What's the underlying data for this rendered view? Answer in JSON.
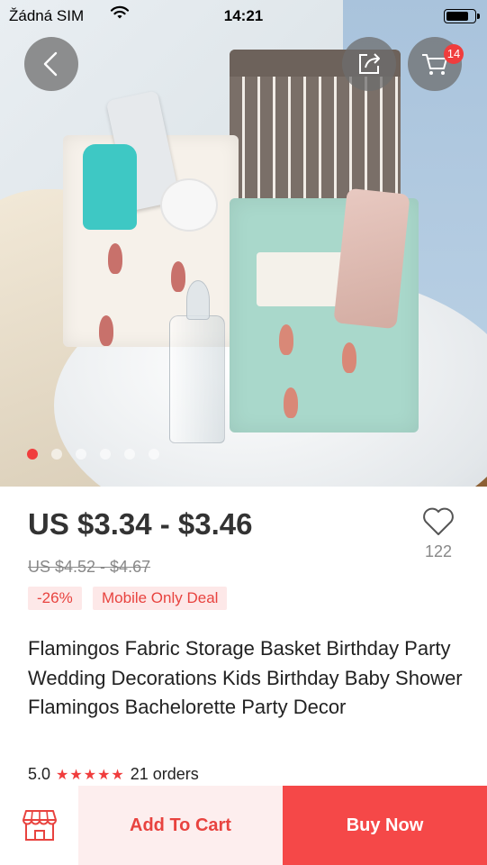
{
  "status_bar": {
    "carrier": "Žádná SIM",
    "time": "14:21"
  },
  "header": {
    "cart_count": "14"
  },
  "gallery": {
    "total_images": 6,
    "active_index": 0
  },
  "product": {
    "price_range": "US $3.34 - $3.46",
    "original_price": "US $4.52 - $4.67",
    "discount_badge": "-26%",
    "deal_badge": "Mobile Only Deal",
    "wishlist_count": "122",
    "title": "Flamingos Fabric Storage Basket Birthday Party Wedding  Decorations Kids Birthday Baby Shower Flamingos Bachelorette Party Decor",
    "rating": "5.0",
    "stars": "★★★★★",
    "orders": "21 orders"
  },
  "actions": {
    "add_to_cart": "Add To Cart",
    "buy_now": "Buy Now"
  },
  "colors": {
    "accent": "#f03d3d",
    "add_to_cart_bg": "#fdeeee",
    "buy_now_bg": "#f54848"
  },
  "icons": [
    "wifi-icon",
    "battery-icon",
    "back-icon",
    "share-icon",
    "cart-icon",
    "heart-icon",
    "store-icon",
    "star-icon"
  ]
}
